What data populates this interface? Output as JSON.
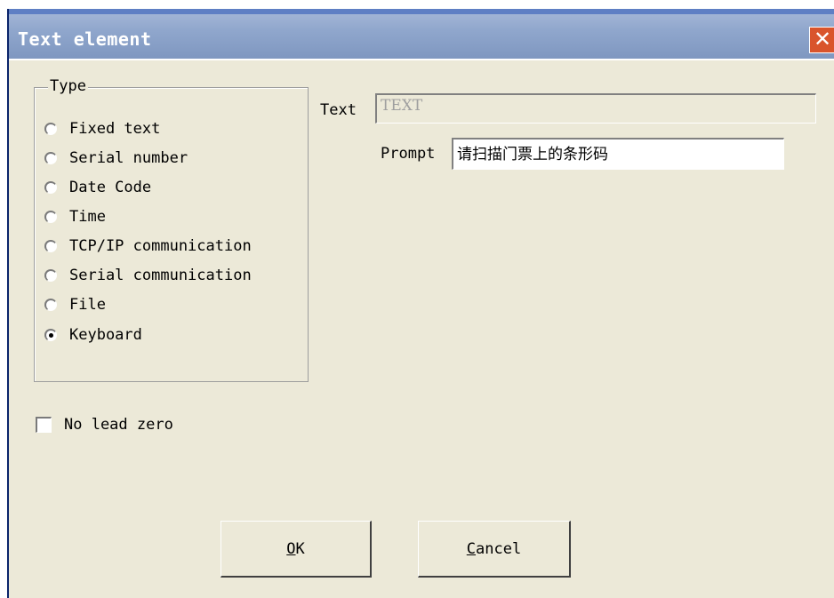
{
  "window": {
    "title": "Text element",
    "close_icon": "close-icon"
  },
  "type_group": {
    "title": "Type",
    "options": [
      {
        "label": "Fixed text",
        "checked": false
      },
      {
        "label": "Serial number",
        "checked": false
      },
      {
        "label": "Date Code",
        "checked": false
      },
      {
        "label": "Time",
        "checked": false
      },
      {
        "label": "TCP/IP communication",
        "checked": false
      },
      {
        "label": "Serial communication",
        "checked": false
      },
      {
        "label": "File",
        "checked": false
      },
      {
        "label": "Keyboard",
        "checked": true
      }
    ]
  },
  "text_field": {
    "label": "Text",
    "value": "TEXT"
  },
  "prompt_field": {
    "label": "Prompt",
    "value": "请扫描门票上的条形码"
  },
  "no_lead_zero": {
    "label": "No lead zero",
    "checked": false
  },
  "buttons": {
    "ok": {
      "mnemonic": "O",
      "rest": "K"
    },
    "cancel": {
      "mnemonic": "C",
      "rest": "ancel"
    }
  },
  "colors": {
    "dialog_bg": "#ece9d8",
    "titlebar": "#8fa6cc",
    "close_button": "#d9542c"
  }
}
